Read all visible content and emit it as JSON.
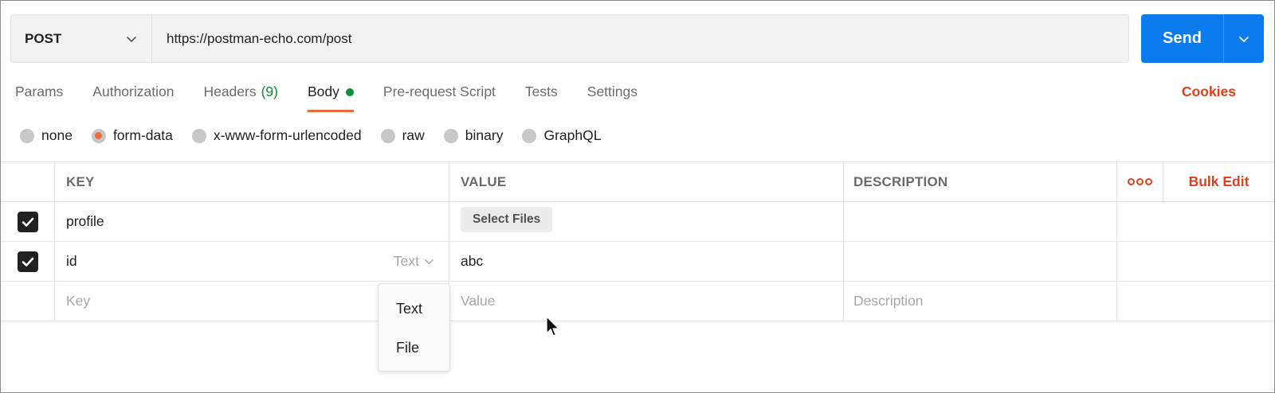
{
  "request": {
    "method": "POST",
    "url": "https://postman-echo.com/post",
    "send_label": "Send"
  },
  "tabs": [
    {
      "label": "Params"
    },
    {
      "label": "Authorization"
    },
    {
      "label": "Headers",
      "count": "(9)"
    },
    {
      "label": "Body",
      "active": true
    },
    {
      "label": "Pre-request Script"
    },
    {
      "label": "Tests"
    },
    {
      "label": "Settings"
    }
  ],
  "cookies_label": "Cookies",
  "body_types": [
    {
      "label": "none"
    },
    {
      "label": "form-data",
      "selected": true
    },
    {
      "label": "x-www-form-urlencoded"
    },
    {
      "label": "raw"
    },
    {
      "label": "binary"
    },
    {
      "label": "GraphQL"
    }
  ],
  "table": {
    "headers": {
      "key": "KEY",
      "value": "VALUE",
      "description": "DESCRIPTION",
      "bulk_edit": "Bulk Edit"
    },
    "rows": [
      {
        "key": "profile",
        "value_button": "Select Files",
        "checked": true
      },
      {
        "key": "id",
        "type": "Text",
        "value": "abc",
        "checked": true
      }
    ],
    "placeholders": {
      "key": "Key",
      "value": "Value",
      "description": "Description"
    }
  },
  "type_menu": {
    "items": [
      "Text",
      "File"
    ]
  },
  "colors": {
    "accent": "#f26b3a",
    "send_blue": "#097bed",
    "link_red": "#e0411b",
    "status_green": "#0c8f3a"
  },
  "icons": {
    "method_dropdown": "chevron-down-icon",
    "send_dropdown": "chevron-down-icon",
    "checkbox": "check-icon",
    "more": "more-horizontal-icon",
    "cursor": "mouse-pointer-icon"
  }
}
